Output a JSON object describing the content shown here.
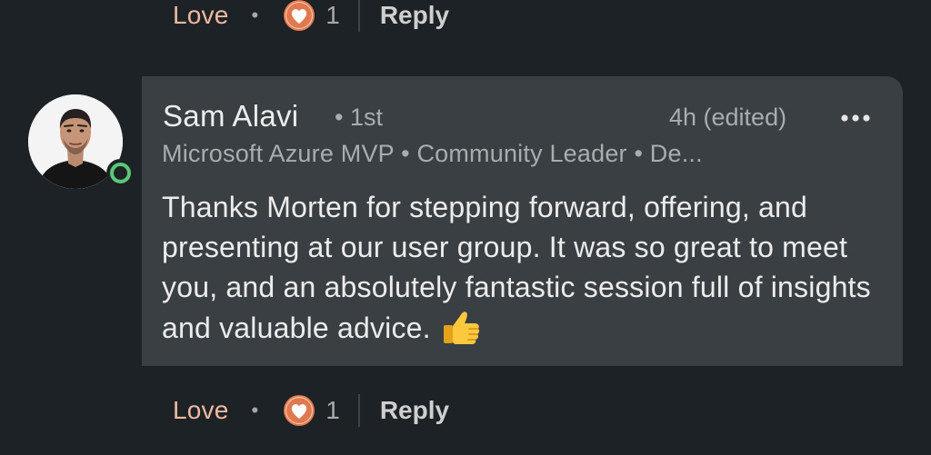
{
  "top_actions": {
    "reaction_label": "Love",
    "separator": "•",
    "reaction_count": "1",
    "reply_label": "Reply"
  },
  "comment": {
    "author": {
      "name": "Sam Alavi",
      "degree": "• 1st",
      "headline": "Microsoft Azure MVP • Community Leader • De...",
      "online": true
    },
    "timestamp": "4h (edited)",
    "more_icon": "ellipsis-icon",
    "text": "Thanks Morten for stepping forward, offering, and presenting at our user group. It was so great to meet you, and an absolutely fantastic session full of insights and valuable advice.",
    "emoji": "thumbs-up-icon"
  },
  "bottom_actions": {
    "reaction_label": "Love",
    "separator": "•",
    "reaction_count": "1",
    "reply_label": "Reply"
  },
  "colors": {
    "background": "#1d2226",
    "bubble": "#3a3f43",
    "love_accent": "#f0b9a0",
    "heart_fill": "#e0794f",
    "online_green": "#5ac878"
  }
}
